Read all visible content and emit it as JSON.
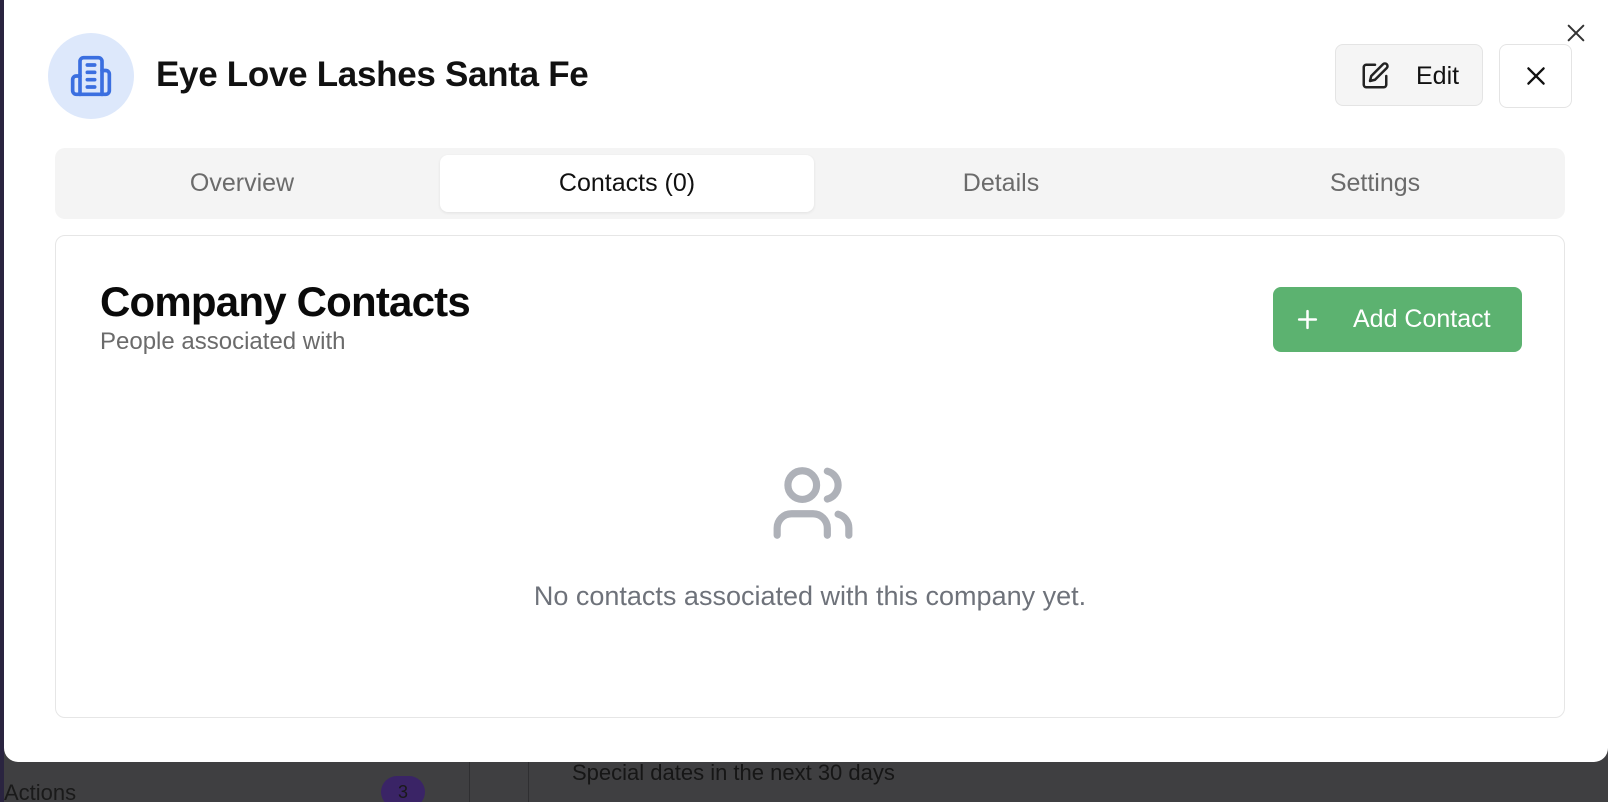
{
  "modal": {
    "company_name": "Eye Love Lashes Santa Fe",
    "avatar_icon": "building-icon",
    "edit_label": "Edit",
    "colors": {
      "avatar_bg": "#dde8fb",
      "avatar_icon": "#3b6fe0",
      "primary_button": "#5cb270"
    }
  },
  "tabs": [
    {
      "label": "Overview",
      "active": false
    },
    {
      "label": "Contacts (0)",
      "active": true
    },
    {
      "label": "Details",
      "active": false
    },
    {
      "label": "Settings",
      "active": false
    }
  ],
  "contacts_panel": {
    "title": "Company Contacts",
    "subtitle": "People associated with",
    "add_button_label": "Add Contact",
    "empty_icon": "users-icon",
    "empty_message": "No contacts associated with this company yet."
  },
  "background": {
    "actions_label": "Actions",
    "actions_badge": "3",
    "special_dates_text": "Special dates in the next 30 days"
  }
}
